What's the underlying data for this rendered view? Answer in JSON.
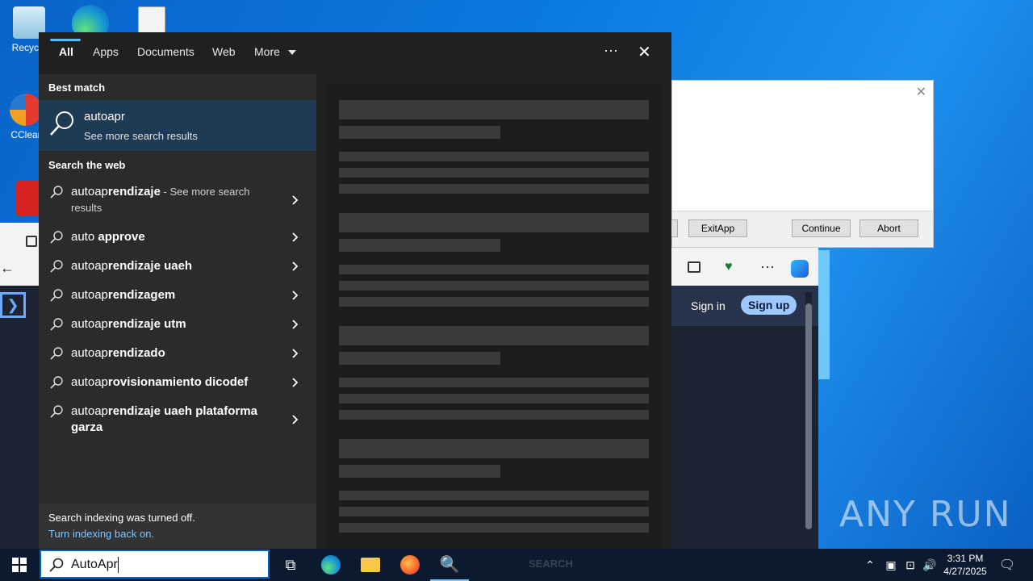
{
  "desktop": {
    "icons": [
      {
        "label": "Recycle"
      },
      {
        "label": "CClear"
      }
    ],
    "watermark": "ANY RUN"
  },
  "dialog": {
    "buttons": [
      "ExitApp",
      "Continue",
      "Abort"
    ]
  },
  "browser": {
    "sign_in": "Sign in",
    "sign_up": "Sign up"
  },
  "search": {
    "tabs": [
      "All",
      "Apps",
      "Documents",
      "Web",
      "More"
    ],
    "best_match_title": "Best match",
    "best_match": {
      "title": "autoapr",
      "subtitle": "See more search results"
    },
    "web_title": "Search the web",
    "web_results": [
      {
        "prefix": "autoap",
        "bold": "rendizaje",
        "suffix": " - See more search",
        "line2": "results"
      },
      {
        "prefix": "auto ",
        "bold": "approve",
        "suffix": "",
        "line2": ""
      },
      {
        "prefix": "autoap",
        "bold": "rendizaje uaeh",
        "suffix": "",
        "line2": ""
      },
      {
        "prefix": "autoap",
        "bold": "rendizagem",
        "suffix": "",
        "line2": ""
      },
      {
        "prefix": "autoap",
        "bold": "rendizaje utm",
        "suffix": "",
        "line2": ""
      },
      {
        "prefix": "autoap",
        "bold": "rendizado",
        "suffix": "",
        "line2": ""
      },
      {
        "prefix": "autoap",
        "bold": "rovisionamiento dicodef",
        "suffix": "",
        "line2": ""
      },
      {
        "prefix": "autoap",
        "bold": "rendizaje uaeh plataforma",
        "suffix": "",
        "line2": "garza"
      }
    ],
    "indexing_text": "Search indexing was turned off.",
    "indexing_link": "Turn indexing back on.",
    "query": "AutoApr"
  },
  "taskbar": {
    "time": "3:31 PM",
    "date": "4/27/2025",
    "ghost_label": "SEARCH"
  },
  "colors": {
    "accent": "#4cc2ff",
    "selected_row": "#1f3a55",
    "panel": "#202020"
  }
}
